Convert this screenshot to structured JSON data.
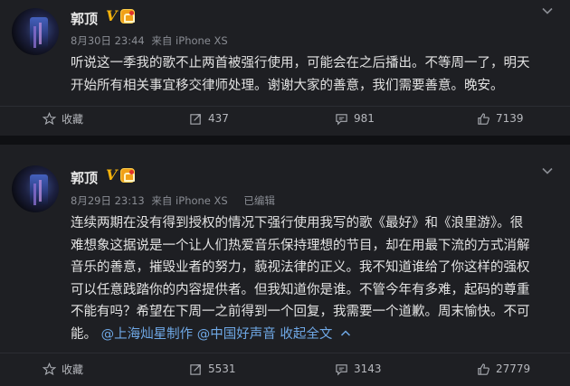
{
  "posts": [
    {
      "username": "郭顶",
      "verified_badge": "V",
      "member_icon": "vip-crown-icon",
      "date": "8月30日 23:44",
      "source": "来自 iPhone XS",
      "edited": "",
      "text_lines": [
        "听说这一季我的歌不止两首被强行使用，可能会在之后播出。不等周一了，明天",
        "开始所有相关事宜移交律师处理。谢谢大家的善意，我们需要善意。晚安。"
      ],
      "actions": {
        "favorite": "收藏",
        "repost": "437",
        "comment": "981",
        "like": "7139"
      }
    },
    {
      "username": "郭顶",
      "verified_badge": "V",
      "member_icon": "vip-crown-icon",
      "date": "8月29日 23:13",
      "source": "来自 iPhone XS",
      "edited": "已编辑",
      "text_lines": [
        "连续两期在没有得到授权的情况下强行使用我写的歌《最好》和《浪里游》。很",
        "难想象这据说是一个让人们热爱音乐保持理想的节目，却在用最下流的方式消解",
        "音乐的善意，摧毁业者的努力，藐视法律的正义。我不知道谁给了你这样的强权",
        "可以任意践踏你的内容提供者。但我知道你是谁。不管今年有多难，起码的尊重",
        "不能有吗？希望在下周一之前得到一个回复，我需要一个道歉。周末愉快。不可"
      ],
      "last_line_text": "能。",
      "mentions": [
        "@上海灿星制作",
        "@中国好声音"
      ],
      "collapse_label": "收起全文",
      "actions": {
        "favorite": "收藏",
        "repost": "5531",
        "comment": "3143",
        "like": "27779"
      }
    }
  ],
  "colors": {
    "background": "#1e1f23",
    "separator": "#0f1013",
    "link": "#6fa8e6",
    "badge_gold": "#f5b30c"
  }
}
